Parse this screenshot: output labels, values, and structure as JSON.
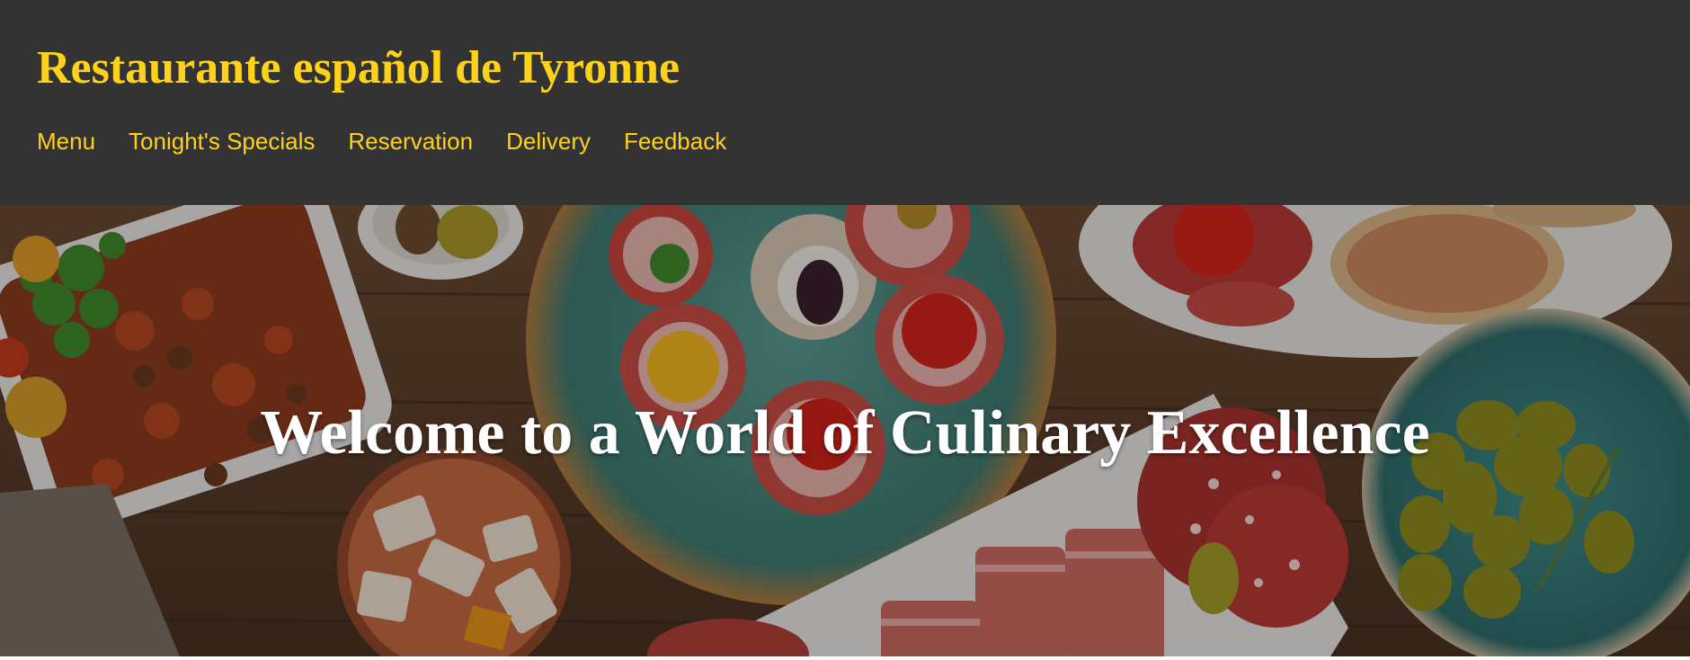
{
  "header": {
    "title": "Restaurante español de Tyronne",
    "nav": [
      {
        "label": "Menu"
      },
      {
        "label": "Tonight's Specials"
      },
      {
        "label": "Reservation"
      },
      {
        "label": "Delivery"
      },
      {
        "label": "Feedback"
      }
    ]
  },
  "hero": {
    "heading": "Welcome to a World of Culinary Excellence"
  },
  "colors": {
    "header_bg": "#333333",
    "accent": "#ffd21a",
    "hero_text": "#ffffff"
  }
}
